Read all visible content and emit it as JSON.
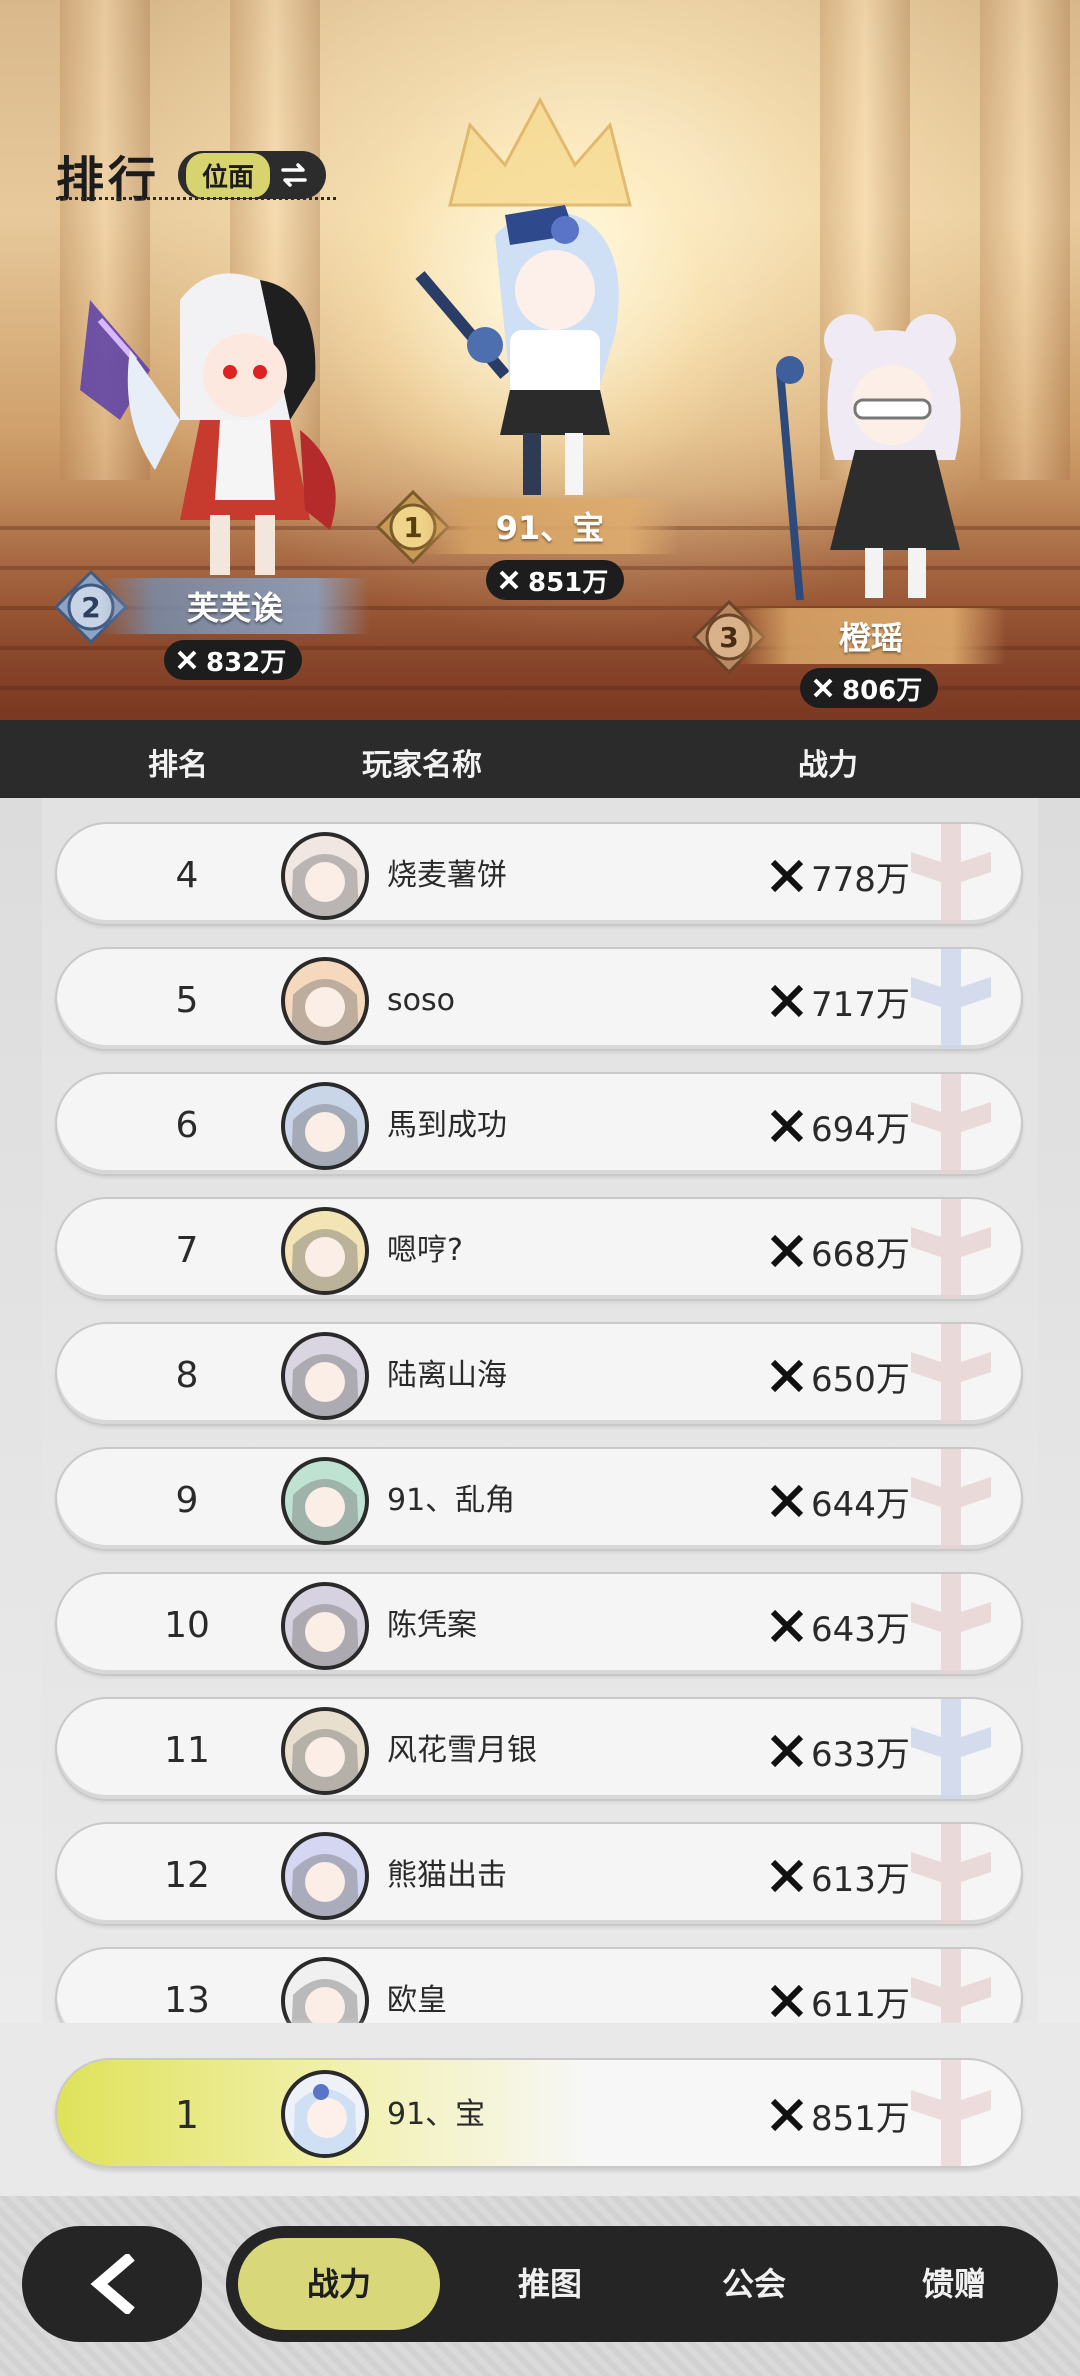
{
  "header": {
    "title": "排行",
    "scope_label": "位面"
  },
  "podium": [
    {
      "rank": "1",
      "name": "91、宝",
      "power": "851万"
    },
    {
      "rank": "2",
      "name": "芙芙诶",
      "power": "832万"
    },
    {
      "rank": "3",
      "name": "橙瑶",
      "power": "806万"
    }
  ],
  "table": {
    "col_rank": "排名",
    "col_name": "玩家名称",
    "col_power": "战力"
  },
  "rows": [
    {
      "rank": "4",
      "name": "烧麦薯饼",
      "power": "778万"
    },
    {
      "rank": "5",
      "name": "soso",
      "power": "717万"
    },
    {
      "rank": "6",
      "name": "馬到成功",
      "power": "694万"
    },
    {
      "rank": "7",
      "name": "嗯哼?",
      "power": "668万"
    },
    {
      "rank": "8",
      "name": "陆离山海",
      "power": "650万"
    },
    {
      "rank": "9",
      "name": "91、乱角",
      "power": "644万"
    },
    {
      "rank": "10",
      "name": "陈凭案",
      "power": "643万"
    },
    {
      "rank": "11",
      "name": "风花雪月银",
      "power": "633万"
    },
    {
      "rank": "12",
      "name": "熊猫出击",
      "power": "613万"
    },
    {
      "rank": "13",
      "name": "欧皇",
      "power": "611万"
    }
  ],
  "my_rank": {
    "rank": "1",
    "name": "91、宝",
    "power": "851万"
  },
  "tabs": [
    "战力",
    "推图",
    "公会",
    "馈赠"
  ],
  "colors": {
    "accent": "#d8d77a",
    "dark": "#252525",
    "header_bar": "#2b2b2b"
  }
}
